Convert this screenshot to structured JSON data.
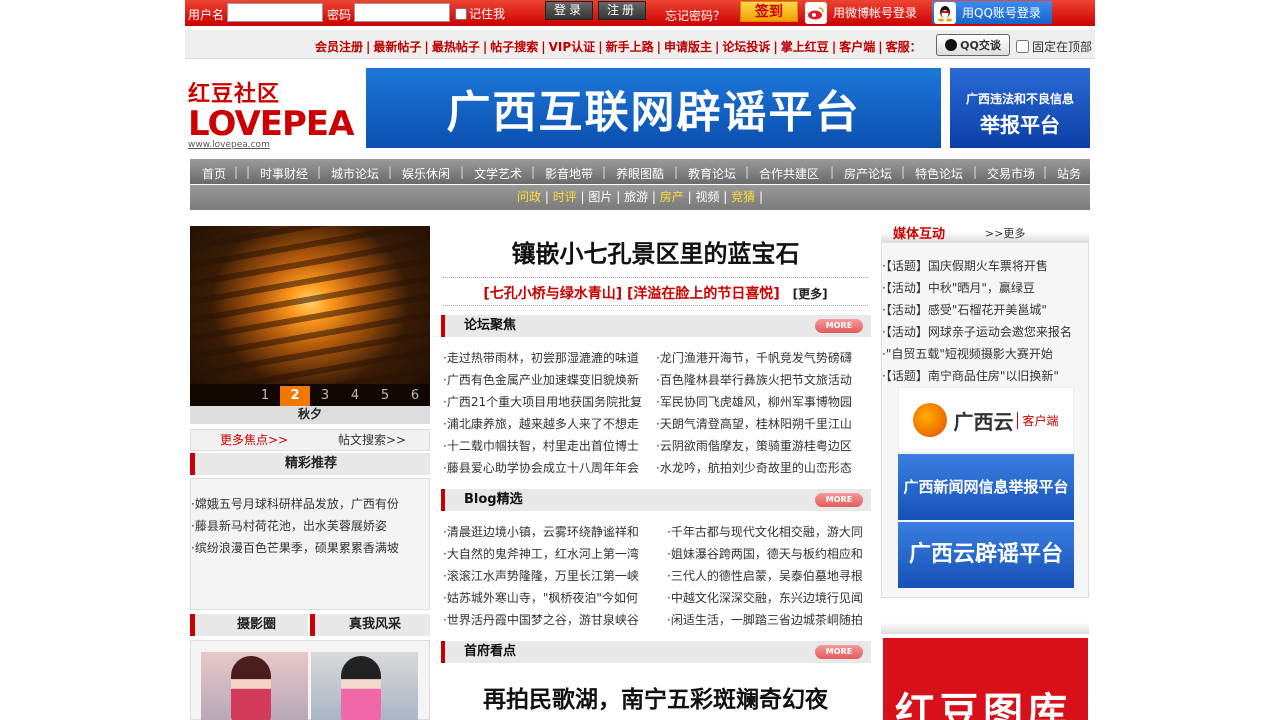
{
  "login": {
    "username_label": "用户名",
    "password_label": "密码",
    "remember_label": "记住我",
    "login_button": "登录",
    "register_button": "注册",
    "forgot": "忘记密码？",
    "signin": "签到",
    "weibo_login": "用微博帐号登录",
    "qq_login": "用QQ账号登录"
  },
  "linkbar": {
    "links": [
      "会员注册",
      "最新帖子",
      "最热帖子",
      "帖子搜索",
      "VIP认证",
      "新手上路",
      "申请版主",
      "论坛投诉",
      "掌上红豆",
      "客户端"
    ],
    "service_label": "客服：",
    "qq_chat": "QQ交谈",
    "pin_label": "固定在顶部"
  },
  "logo": {
    "cn": "红豆社区",
    "en": "LOVEPEA",
    "url": "www.lovepea.com"
  },
  "banners": {
    "main": "广西互联网辟谣平台",
    "side_l1": "广西违法和不良信息",
    "side_l2": "举报平台"
  },
  "mainnav": [
    "首页",
    "时事财经",
    "城市论坛",
    "娱乐休闲",
    "文学艺术",
    "影音地带",
    "养眼图酷",
    "教育论坛",
    "合作共建区",
    "房产论坛",
    "特色论坛",
    "交易市场",
    "站务"
  ],
  "subnav": [
    {
      "label": "问政",
      "hl": true
    },
    {
      "label": "时评",
      "hl": true
    },
    {
      "label": "图片",
      "hl": false
    },
    {
      "label": "旅游",
      "hl": false
    },
    {
      "label": "房产",
      "hl": true
    },
    {
      "label": "视频",
      "hl": false
    },
    {
      "label": "竞猜",
      "hl": true
    }
  ],
  "slider": {
    "pages": [
      "1",
      "2",
      "3",
      "4",
      "5",
      "6"
    ],
    "active": 1,
    "caption": "秋夕",
    "more_focus": "更多焦点>>",
    "post_search": "帖文搜索>>"
  },
  "recommend": {
    "title": "精彩推荐",
    "items": [
      "·嫦娥五号月球科研样品发放，广西有份",
      "·藤县新马村荷花池，出水芙蓉展娇姿",
      "·缤纷浪漫百色芒果季，硕果累累香满坡"
    ]
  },
  "photo": {
    "title": "摄影圈"
  },
  "real": {
    "title": "真我风采"
  },
  "center": {
    "headline": "镶嵌小七孔景区里的蓝宝石",
    "sub1": "[七孔小桥与绿水青山]",
    "sub2": "[洋溢在脸上的节日喜悦]",
    "sub_more": "[更多]",
    "more_label": "MORE",
    "forum": {
      "title": "论坛聚焦",
      "left": [
        "·走过热带雨林，初尝那湿漉漉的味道",
        "·广西有色金属产业加速蝶变旧貌焕新",
        "·广西21个重大项目用地获国务院批复",
        "·浦北康养旅，越来越多人来了不想走",
        "·十二载巾帼扶智，村里走出首位博士",
        "·藤县爱心助学协会成立十八周年年会"
      ],
      "right": [
        "·龙门渔港开海节，千帆竞发气势磅礴",
        "·百色隆林县举行彝族火把节文旅活动",
        "·军民协同飞虎雄风，柳州军事博物园",
        "·天朗气清登高望，桂林阳朔千里江山",
        "·云阴欲雨偕摩友，策骑重游桂粤边区",
        "·水龙吟，航拍刘少奇故里的山峦形态"
      ]
    },
    "blog": {
      "title": "Blog精选",
      "left": [
        "·清晨逛边境小镇，云雾环绕静谧祥和",
        "·大自然的鬼斧神工，红水河上第一湾",
        "·滚滚江水声势隆隆，万里长江第一峡",
        "·姑苏城外寒山寺，\"枫桥夜泊\"今如何",
        "·世界活丹霞中国梦之谷，游甘泉峡谷"
      ],
      "right": [
        "·千年古都与现代文化相交融，游大同",
        "·姐妹瀑谷跨两国，德天与板约相应和",
        "·三代人的德性启蒙，吴泰伯墓地寻根",
        "·中越文化深深交融，东兴边境行见闻",
        "·闲适生活，一脚踏三省边城茶峒随拍"
      ]
    },
    "gov": {
      "title": "首府看点",
      "headline": "再拍民歌湖，南宁五彩斑斓奇幻夜"
    }
  },
  "media": {
    "title": "媒体互动",
    "more": ">>更多",
    "items": [
      "·【话题】国庆假期火车票将开售",
      "·【活动】中秋\"晒月\"，赢绿豆",
      "·【活动】感受\"石榴花开美邕城\"",
      "·【活动】网球亲子运动会邀您来报名",
      "·\"自贸五载\"短视频摄影大赛开始",
      "·【话题】南宁商品住房\"以旧换新\""
    ],
    "banner1": "广西云",
    "banner1_sub": "客户端",
    "banner2": "广西新闻网信息举报平台",
    "banner3": "广西云辟谣平台"
  },
  "album": {
    "title": "红豆图库"
  }
}
